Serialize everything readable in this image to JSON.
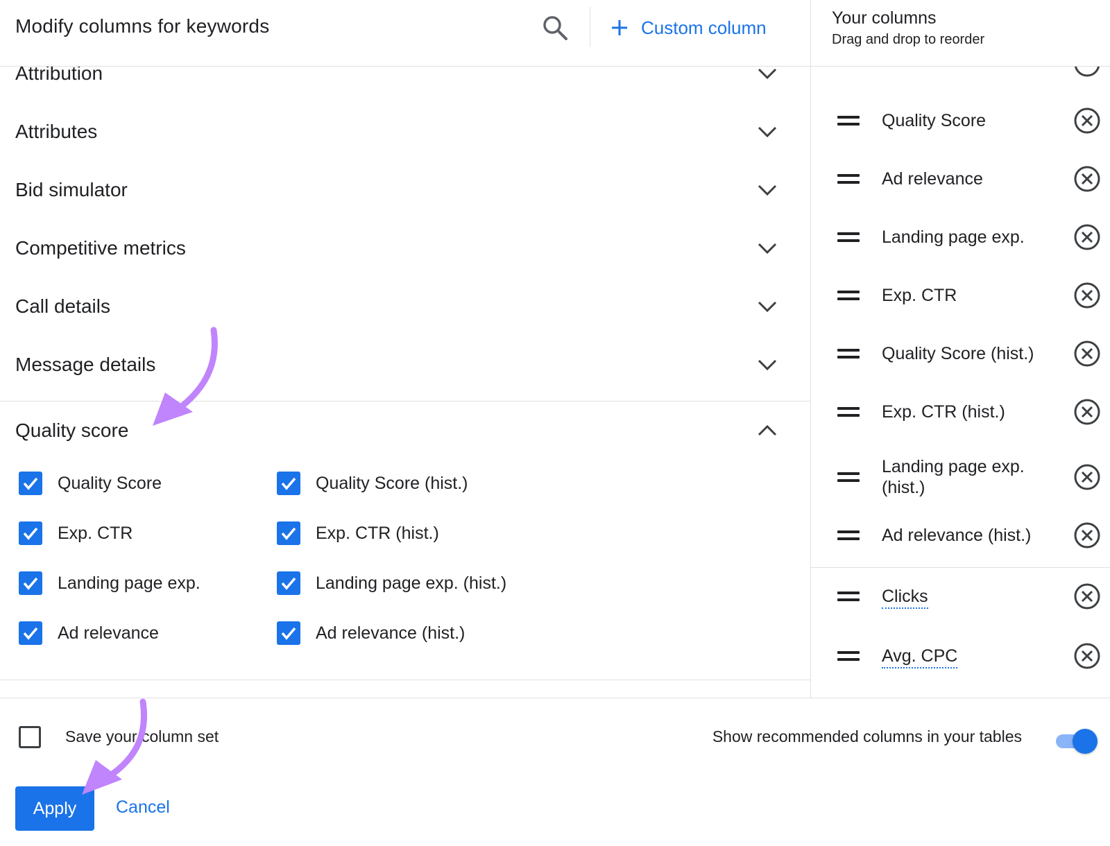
{
  "left": {
    "title": "Modify columns for keywords",
    "custom_column_label": "Custom column",
    "groups": [
      {
        "label": "Attribution",
        "expanded": false
      },
      {
        "label": "Attributes",
        "expanded": false
      },
      {
        "label": "Bid simulator",
        "expanded": false
      },
      {
        "label": "Competitive metrics",
        "expanded": false
      },
      {
        "label": "Call details",
        "expanded": false
      },
      {
        "label": "Message details",
        "expanded": false
      },
      {
        "label": "Quality score",
        "expanded": true
      }
    ],
    "quality_score_options": [
      {
        "label": "Quality Score",
        "checked": true
      },
      {
        "label": "Quality Score (hist.)",
        "checked": true
      },
      {
        "label": "Exp. CTR",
        "checked": true
      },
      {
        "label": "Exp. CTR (hist.)",
        "checked": true
      },
      {
        "label": "Landing page exp.",
        "checked": true
      },
      {
        "label": "Landing page exp. (hist.)",
        "checked": true
      },
      {
        "label": "Ad relevance",
        "checked": true
      },
      {
        "label": "Ad relevance (hist.)",
        "checked": true
      }
    ]
  },
  "right": {
    "title": "Your columns",
    "subtitle": "Drag and drop to reorder",
    "columns": [
      {
        "label": "Quality Score"
      },
      {
        "label": "Ad relevance"
      },
      {
        "label": "Landing page exp."
      },
      {
        "label": "Exp. CTR"
      },
      {
        "label": "Quality Score (hist.)"
      },
      {
        "label": "Exp. CTR (hist.)"
      },
      {
        "label": "Landing page exp. (hist.)"
      },
      {
        "label": "Ad relevance (hist.)"
      },
      {
        "label": "Clicks"
      },
      {
        "label": "Avg. CPC"
      }
    ]
  },
  "footer": {
    "save_label": "Save your column set",
    "save_checked": false,
    "recommended_label": "Show recommended columns in your tables",
    "recommended_on": true,
    "apply_label": "Apply",
    "cancel_label": "Cancel"
  },
  "colors": {
    "accent": "#1a73e8",
    "annotation_arrow": "#c084fc"
  },
  "icons": {
    "search": "search-icon",
    "add": "plus-icon",
    "expand": "chevron-down-icon",
    "collapse": "chevron-up-icon",
    "checked": "check-icon",
    "drag": "drag-handle-icon",
    "remove": "remove-circle-icon"
  }
}
